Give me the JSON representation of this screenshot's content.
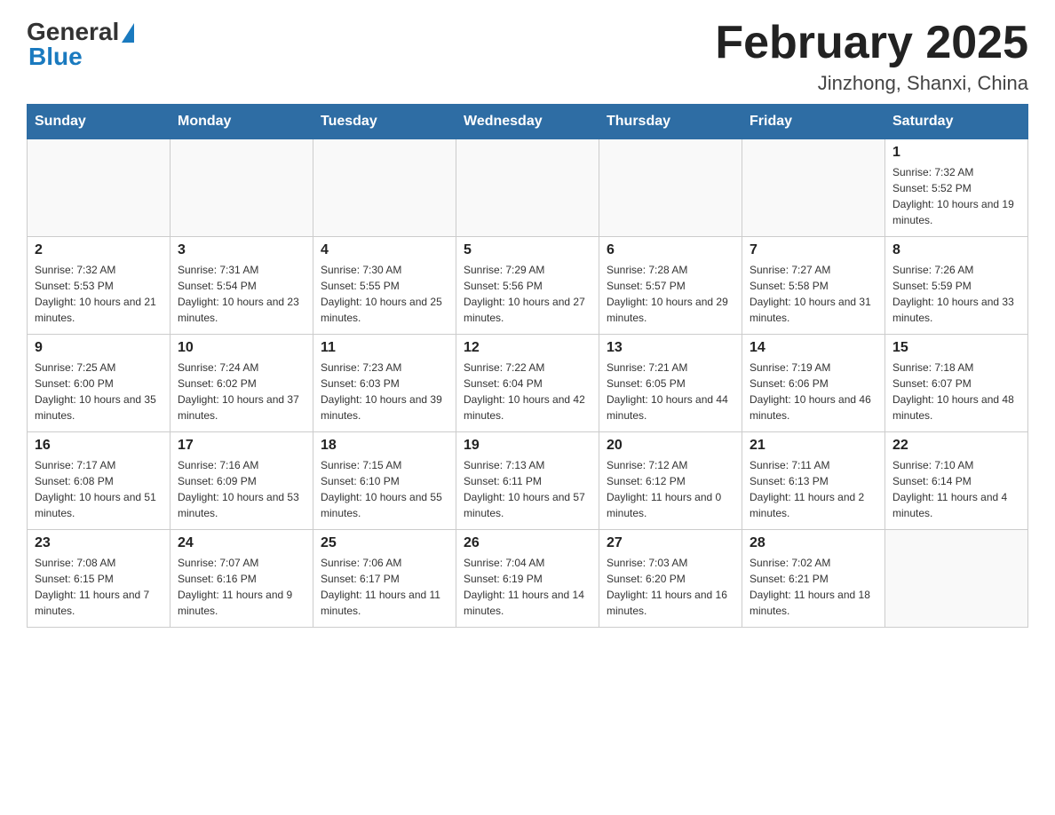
{
  "logo": {
    "general": "General",
    "blue": "Blue"
  },
  "title": "February 2025",
  "subtitle": "Jinzhong, Shanxi, China",
  "days_of_week": [
    "Sunday",
    "Monday",
    "Tuesday",
    "Wednesday",
    "Thursday",
    "Friday",
    "Saturday"
  ],
  "weeks": [
    [
      {
        "day": "",
        "info": ""
      },
      {
        "day": "",
        "info": ""
      },
      {
        "day": "",
        "info": ""
      },
      {
        "day": "",
        "info": ""
      },
      {
        "day": "",
        "info": ""
      },
      {
        "day": "",
        "info": ""
      },
      {
        "day": "1",
        "info": "Sunrise: 7:32 AM\nSunset: 5:52 PM\nDaylight: 10 hours and 19 minutes."
      }
    ],
    [
      {
        "day": "2",
        "info": "Sunrise: 7:32 AM\nSunset: 5:53 PM\nDaylight: 10 hours and 21 minutes."
      },
      {
        "day": "3",
        "info": "Sunrise: 7:31 AM\nSunset: 5:54 PM\nDaylight: 10 hours and 23 minutes."
      },
      {
        "day": "4",
        "info": "Sunrise: 7:30 AM\nSunset: 5:55 PM\nDaylight: 10 hours and 25 minutes."
      },
      {
        "day": "5",
        "info": "Sunrise: 7:29 AM\nSunset: 5:56 PM\nDaylight: 10 hours and 27 minutes."
      },
      {
        "day": "6",
        "info": "Sunrise: 7:28 AM\nSunset: 5:57 PM\nDaylight: 10 hours and 29 minutes."
      },
      {
        "day": "7",
        "info": "Sunrise: 7:27 AM\nSunset: 5:58 PM\nDaylight: 10 hours and 31 minutes."
      },
      {
        "day": "8",
        "info": "Sunrise: 7:26 AM\nSunset: 5:59 PM\nDaylight: 10 hours and 33 minutes."
      }
    ],
    [
      {
        "day": "9",
        "info": "Sunrise: 7:25 AM\nSunset: 6:00 PM\nDaylight: 10 hours and 35 minutes."
      },
      {
        "day": "10",
        "info": "Sunrise: 7:24 AM\nSunset: 6:02 PM\nDaylight: 10 hours and 37 minutes."
      },
      {
        "day": "11",
        "info": "Sunrise: 7:23 AM\nSunset: 6:03 PM\nDaylight: 10 hours and 39 minutes."
      },
      {
        "day": "12",
        "info": "Sunrise: 7:22 AM\nSunset: 6:04 PM\nDaylight: 10 hours and 42 minutes."
      },
      {
        "day": "13",
        "info": "Sunrise: 7:21 AM\nSunset: 6:05 PM\nDaylight: 10 hours and 44 minutes."
      },
      {
        "day": "14",
        "info": "Sunrise: 7:19 AM\nSunset: 6:06 PM\nDaylight: 10 hours and 46 minutes."
      },
      {
        "day": "15",
        "info": "Sunrise: 7:18 AM\nSunset: 6:07 PM\nDaylight: 10 hours and 48 minutes."
      }
    ],
    [
      {
        "day": "16",
        "info": "Sunrise: 7:17 AM\nSunset: 6:08 PM\nDaylight: 10 hours and 51 minutes."
      },
      {
        "day": "17",
        "info": "Sunrise: 7:16 AM\nSunset: 6:09 PM\nDaylight: 10 hours and 53 minutes."
      },
      {
        "day": "18",
        "info": "Sunrise: 7:15 AM\nSunset: 6:10 PM\nDaylight: 10 hours and 55 minutes."
      },
      {
        "day": "19",
        "info": "Sunrise: 7:13 AM\nSunset: 6:11 PM\nDaylight: 10 hours and 57 minutes."
      },
      {
        "day": "20",
        "info": "Sunrise: 7:12 AM\nSunset: 6:12 PM\nDaylight: 11 hours and 0 minutes."
      },
      {
        "day": "21",
        "info": "Sunrise: 7:11 AM\nSunset: 6:13 PM\nDaylight: 11 hours and 2 minutes."
      },
      {
        "day": "22",
        "info": "Sunrise: 7:10 AM\nSunset: 6:14 PM\nDaylight: 11 hours and 4 minutes."
      }
    ],
    [
      {
        "day": "23",
        "info": "Sunrise: 7:08 AM\nSunset: 6:15 PM\nDaylight: 11 hours and 7 minutes."
      },
      {
        "day": "24",
        "info": "Sunrise: 7:07 AM\nSunset: 6:16 PM\nDaylight: 11 hours and 9 minutes."
      },
      {
        "day": "25",
        "info": "Sunrise: 7:06 AM\nSunset: 6:17 PM\nDaylight: 11 hours and 11 minutes."
      },
      {
        "day": "26",
        "info": "Sunrise: 7:04 AM\nSunset: 6:19 PM\nDaylight: 11 hours and 14 minutes."
      },
      {
        "day": "27",
        "info": "Sunrise: 7:03 AM\nSunset: 6:20 PM\nDaylight: 11 hours and 16 minutes."
      },
      {
        "day": "28",
        "info": "Sunrise: 7:02 AM\nSunset: 6:21 PM\nDaylight: 11 hours and 18 minutes."
      },
      {
        "day": "",
        "info": ""
      }
    ]
  ]
}
